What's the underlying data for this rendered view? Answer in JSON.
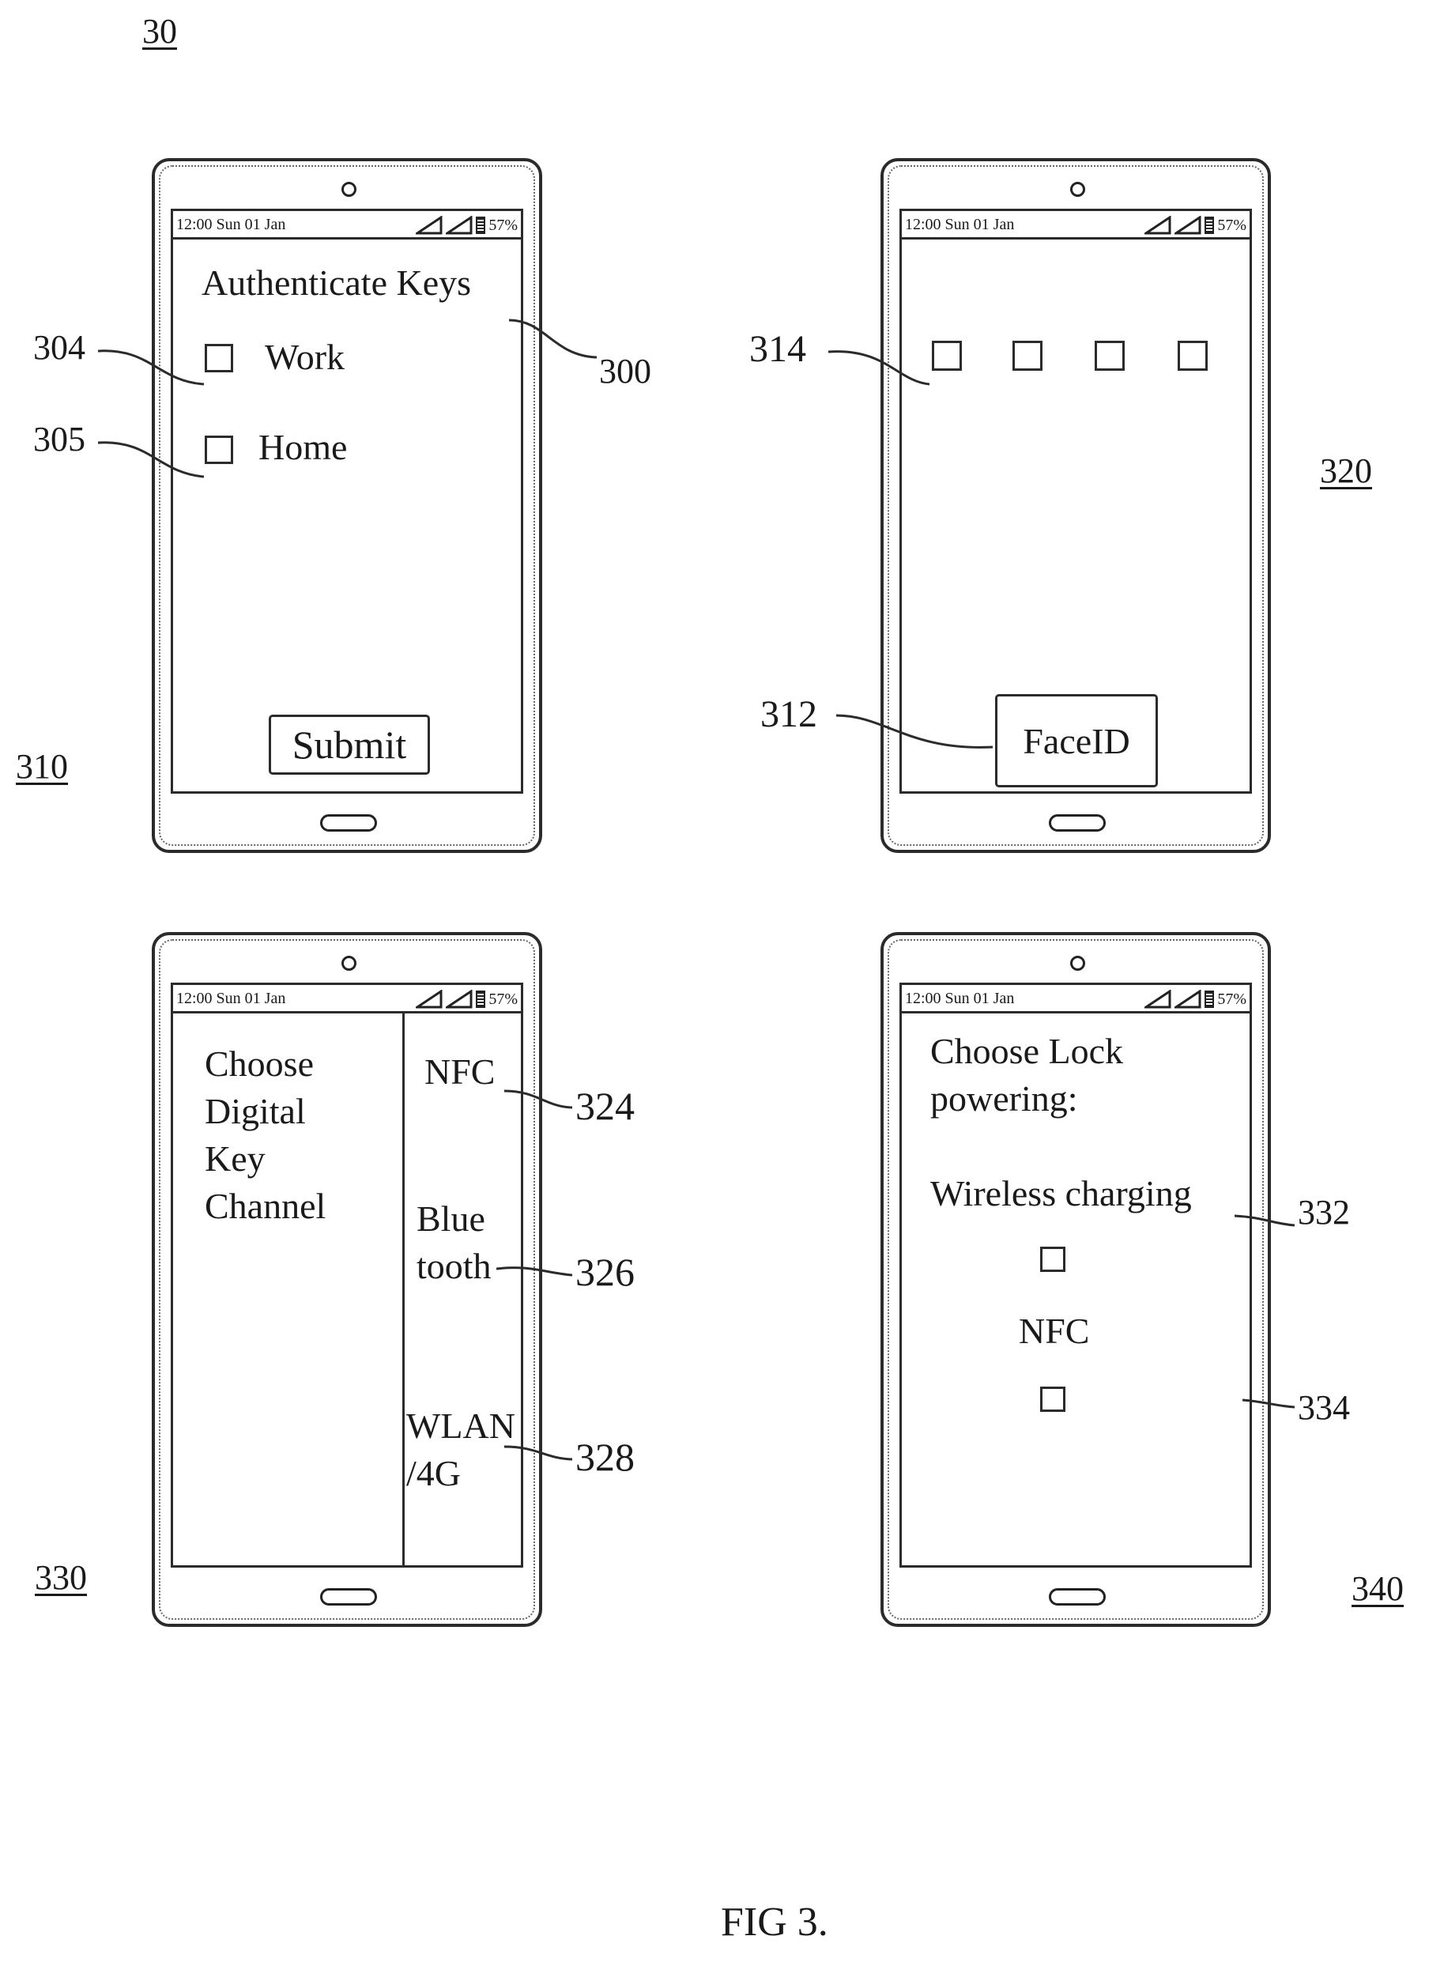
{
  "figure": {
    "number_label": "30",
    "caption": "FIG 3."
  },
  "status_bar": {
    "time": "12:00 Sun 01 Jan",
    "battery": "57%",
    "icons": [
      "signal-icon",
      "signal-icon",
      "battery-icon"
    ]
  },
  "screen_310": {
    "ref": "310",
    "title": "Authenticate Keys",
    "title_ref": "300",
    "options": [
      {
        "label": "Work",
        "ref": "304"
      },
      {
        "label": "Home",
        "ref": "305"
      }
    ],
    "submit_label": "Submit"
  },
  "screen_320": {
    "ref": "320",
    "pin_ref": "314",
    "pin_boxes": 4,
    "faceid_label": "FaceID",
    "faceid_ref": "312"
  },
  "screen_330": {
    "ref": "330",
    "prompt_lines": [
      "Choose",
      "Digital",
      "Key",
      "Channel"
    ],
    "channels": [
      {
        "lines": [
          "NFC"
        ],
        "ref": "324"
      },
      {
        "lines": [
          "Blue",
          "tooth"
        ],
        "ref": "326"
      },
      {
        "lines": [
          "WLAN",
          "/4G"
        ],
        "ref": "328"
      }
    ]
  },
  "screen_340": {
    "ref": "340",
    "prompt_lines": [
      "Choose Lock",
      "powering:"
    ],
    "options": [
      {
        "label": "Wireless charging",
        "ref": "332"
      },
      {
        "label": "NFC",
        "ref": "334"
      }
    ]
  }
}
